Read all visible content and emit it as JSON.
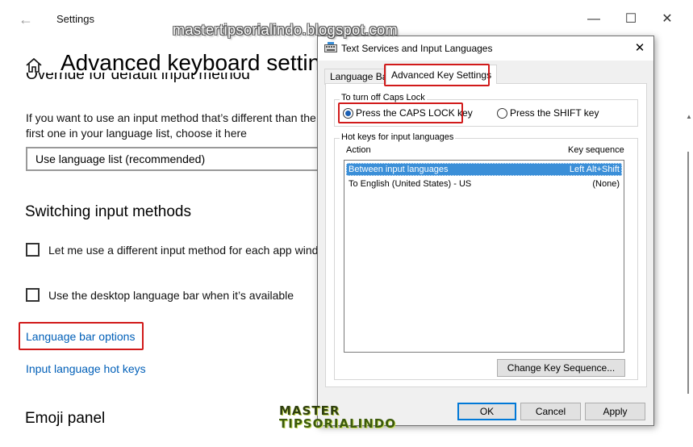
{
  "settings": {
    "app_title": "Settings",
    "page_title": "Advanced keyboard settings",
    "cut_heading": "Override for default input method",
    "description": "If you want to use an input method that’s different than the first one in your language list, choose it here",
    "dropdown_value": "Use language list (recommended)",
    "switching_heading": "Switching input methods",
    "checkbox_per_app": "Let me use a different input method for each app window",
    "checkbox_desktop_bar": "Use the desktop language bar when it’s available",
    "link_language_bar": "Language bar options",
    "link_hot_keys": "Input language hot keys",
    "emoji_heading": "Emoji panel",
    "window_controls": {
      "minimize": "—",
      "maximize": "☐",
      "close": "✕"
    }
  },
  "dialog": {
    "title": "Text Services and Input Languages",
    "close_glyph": "✕",
    "tabs": [
      {
        "label": "Language Bar",
        "active": false
      },
      {
        "label": "Advanced Key Settings",
        "active": true
      }
    ],
    "caps_group_title": "To turn off Caps Lock",
    "caps_options": [
      {
        "label": "Press the CAPS LOCK key",
        "selected": true
      },
      {
        "label": "Press the SHIFT key",
        "selected": false
      }
    ],
    "hotkeys_group_title": "Hot keys for input languages",
    "columns": {
      "action": "Action",
      "key": "Key sequence"
    },
    "rows": [
      {
        "action": "Between input languages",
        "key": "Left Alt+Shift",
        "selected": true
      },
      {
        "action": "To English (United States) - US",
        "key": "(None)",
        "selected": false
      }
    ],
    "change_button": "Change Key Sequence...",
    "ok_button": "OK",
    "cancel_button": "Cancel",
    "apply_button": "Apply"
  },
  "watermark": {
    "url": "mastertipsorialindo.blogspot.com",
    "logo_line1": "MASTER",
    "logo_line2": "TIPSORIALINDO"
  },
  "colors": {
    "highlight_red": "#d11a1a",
    "link_blue": "#005fb8",
    "selection_blue": "#3b8fd8"
  }
}
